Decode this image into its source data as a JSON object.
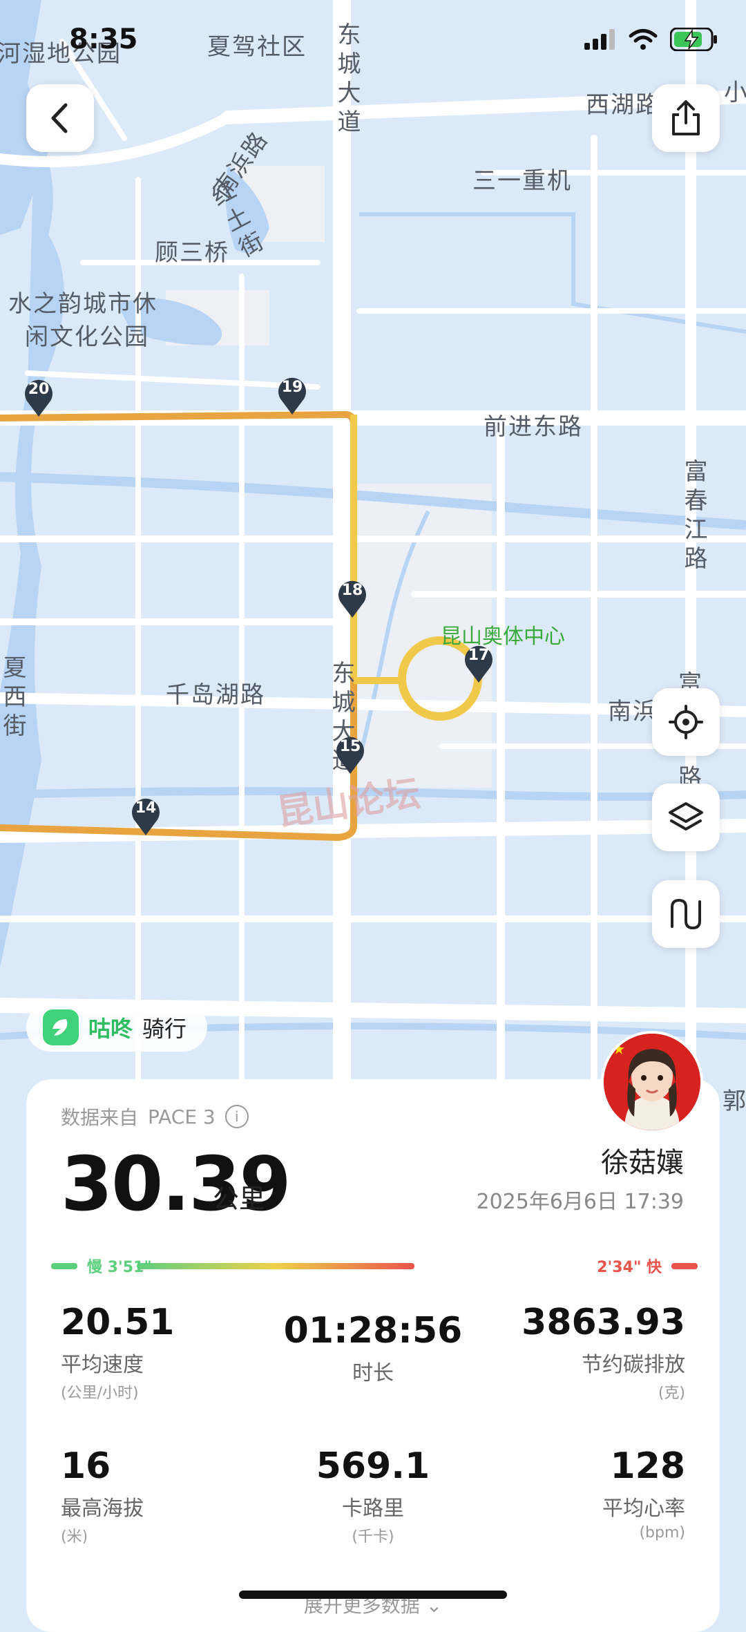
{
  "status_bar": {
    "time": "8:35"
  },
  "map": {
    "labels": [
      {
        "text": "河湿地公园",
        "cls": "",
        "style": "left:-4px;top:50px"
      },
      {
        "text": "夏驾社区",
        "cls": "",
        "style": "left:300px;top:40px"
      },
      {
        "text": "东城大道",
        "cls": "vert",
        "style": "left:478px;top:32px"
      },
      {
        "text": "西湖路",
        "cls": "",
        "style": "left:848px;top:124px"
      },
      {
        "text": "小",
        "cls": "",
        "style": "left:1048px;top:106px"
      },
      {
        "text": "三一重机",
        "cls": "",
        "style": "left:684px;top:234px"
      },
      {
        "text": "南浜路",
        "cls": "",
        "style": "left:292px;top:212px;transform:rotate(-55deg)"
      },
      {
        "text": "红土街",
        "cls": "vert",
        "style": "left:318px;top:258px;transform:rotate(-28deg)"
      },
      {
        "text": "顾三桥",
        "cls": "",
        "style": "left:224px;top:338px"
      },
      {
        "text": "水之韵城市休",
        "cls": "",
        "style": "left:12px;top:412px"
      },
      {
        "text": "闲文化公园",
        "cls": "",
        "style": "left:36px;top:460px"
      },
      {
        "text": "前进东路",
        "cls": "",
        "style": "left:700px;top:590px"
      },
      {
        "text": "富春江路",
        "cls": "vert",
        "style": "left:980px;top:664px"
      },
      {
        "text": "昆山奥体中心",
        "cls": "green",
        "style": "left:638px;top:896px"
      },
      {
        "text": "东城大道",
        "cls": "vert",
        "style": "left:470px;top:956px"
      },
      {
        "text": "千岛湖路",
        "cls": "",
        "style": "left:240px;top:978px"
      },
      {
        "text": "南浜",
        "cls": "",
        "style": "left:880px;top:1002px"
      },
      {
        "text": "富",
        "cls": "",
        "style": "left:982px;top:962px"
      },
      {
        "text": "路",
        "cls": "",
        "style": "left:982px;top:1098px"
      },
      {
        "text": "夏西街",
        "cls": "vert",
        "style": "left:-6px;top:948px"
      },
      {
        "text": "郭",
        "cls": "",
        "style": "left:1046px;top:1566px"
      }
    ],
    "markers": [
      {
        "label": "20",
        "style": "left:33px;top:545px"
      },
      {
        "label": "19",
        "style": "left:400px;top:542px"
      },
      {
        "label": "18",
        "style": "left:487px;top:836px"
      },
      {
        "label": "17",
        "style": "left:670px;top:930px"
      },
      {
        "label": "15",
        "style": "left:484px;top:1062px"
      },
      {
        "label": "14",
        "style": "left:188px;top:1151px"
      }
    ],
    "watermark": "昆山论坛"
  },
  "controls": {
    "back": "chevron-left-icon",
    "share": "share-icon",
    "locate": "locate-icon",
    "layers": "layers-icon",
    "route": "route-icon"
  },
  "brand": {
    "name": "咕咚",
    "activity": "骑行"
  },
  "summary": {
    "source_label": "数据来自",
    "source_device": "PACE 3",
    "distance": "30.39",
    "distance_unit": "公里",
    "user": "徐菇孃",
    "date": "2025年6月6日 17:39",
    "pace_slow": "慢 3'51\"",
    "pace_fast": "2'34\" 快",
    "stats": [
      {
        "value": "20.51",
        "label": "平均速度",
        "unit": "(公里/小时)"
      },
      {
        "value": "01:28:56",
        "label": "时长",
        "unit": ""
      },
      {
        "value": "3863.93",
        "label": "节约碳排放",
        "unit": "(克)"
      },
      {
        "value": "16",
        "label": "最高海拔",
        "unit": "(米)"
      },
      {
        "value": "569.1",
        "label": "卡路里",
        "unit": "(千卡)"
      },
      {
        "value": "128",
        "label": "平均心率",
        "unit": "(bpm)"
      }
    ],
    "expand": "展开更多数据"
  },
  "colors": {
    "route_orange": "#e8a441",
    "route_yellow": "#f0c84a",
    "marker": "#2f3a48",
    "pace_green": "#5ccf7d",
    "pace_red": "#e8544a"
  }
}
